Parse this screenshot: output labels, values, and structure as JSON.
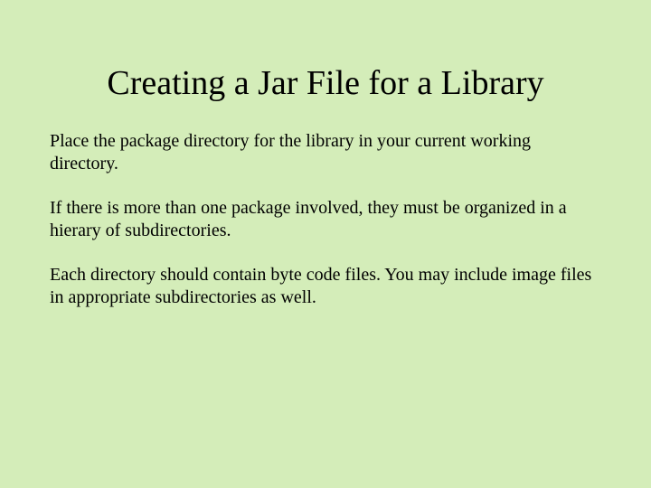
{
  "slide": {
    "title": "Creating a Jar File for a Library",
    "paragraphs": [
      "Place the package directory for the library in your current working directory.",
      "If there is more than one package involved, they must be organized in a hierary of subdirectories.",
      "Each directory should contain byte code files.  You may include image files in appropriate subdirectories as well."
    ]
  }
}
